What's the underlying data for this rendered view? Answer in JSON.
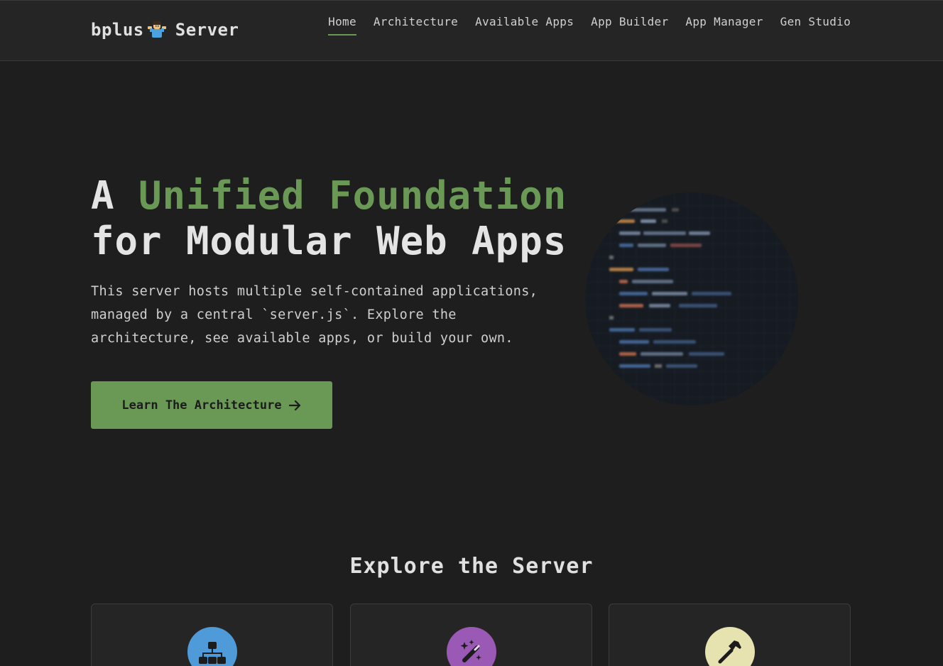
{
  "brand": {
    "name": "bplus",
    "suffix": "Server",
    "emoji_icon": "person-shrugging-icon"
  },
  "nav": {
    "items": [
      {
        "label": "Home",
        "active": true
      },
      {
        "label": "Architecture",
        "active": false
      },
      {
        "label": "Available Apps",
        "active": false
      },
      {
        "label": "App Builder",
        "active": false
      },
      {
        "label": "App Manager",
        "active": false
      },
      {
        "label": "Gen Studio",
        "active": false
      }
    ]
  },
  "hero": {
    "title_lead": "A ",
    "title_accent": "Unified Foundation",
    "title_line2": "for Modular Web Apps",
    "description": "This server hosts multiple self-contained applications, managed by a central `server.js`. Explore the architecture, see available apps, or build your own.",
    "cta_label": "Learn The Architecture",
    "cta_icon": "arrow-right-icon"
  },
  "explore": {
    "title": "Explore the Server",
    "cards": [
      {
        "icon": "sitemap-icon",
        "color": "#4f9ad8"
      },
      {
        "icon": "magic-wand-icon",
        "color": "#9b59b6"
      },
      {
        "icon": "hammer-icon",
        "color": "#e6e3b0"
      }
    ]
  },
  "colors": {
    "accent": "#6a9955",
    "background": "#1e1e1e",
    "header": "#252526"
  }
}
